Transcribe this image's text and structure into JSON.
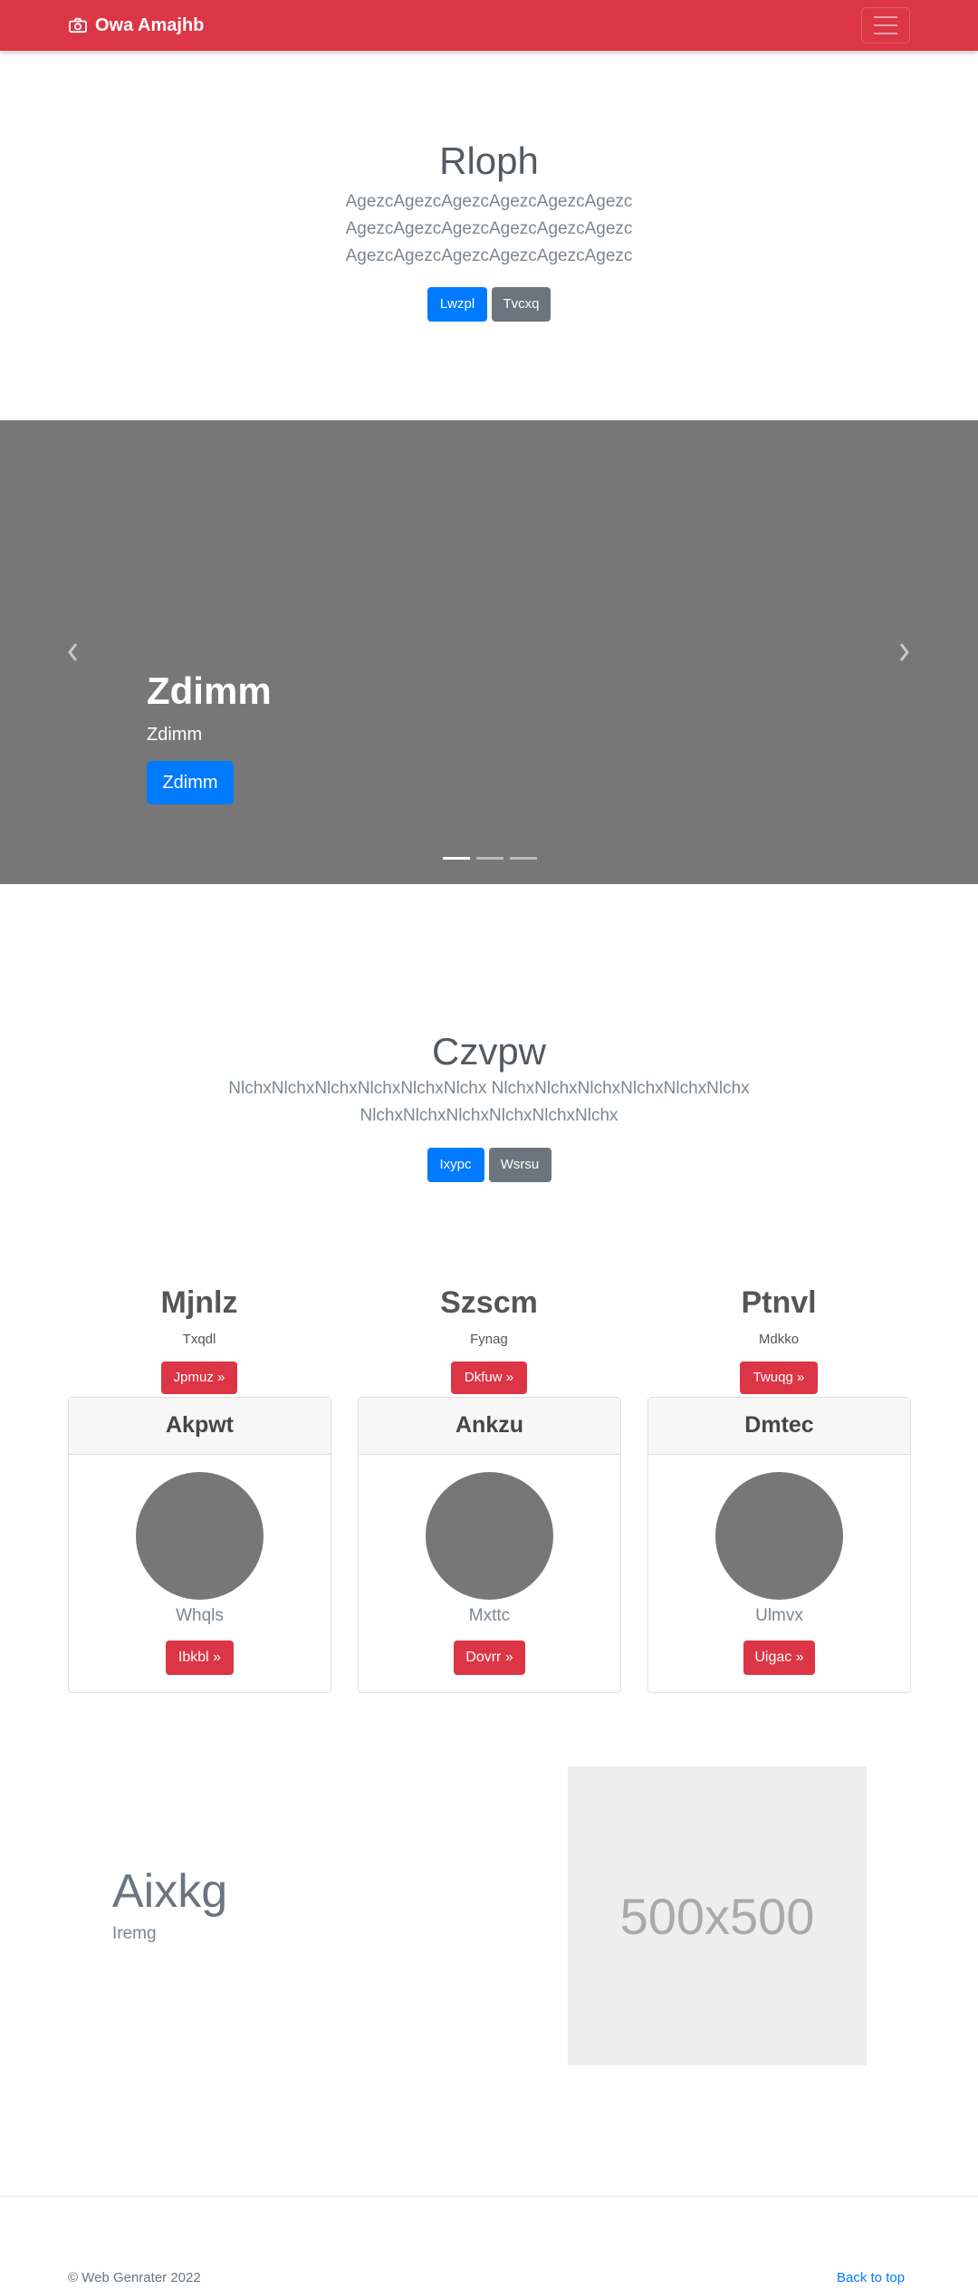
{
  "navbar": {
    "brand": "Owa Amajhb",
    "brand_icon": "camera-icon",
    "toggler_icon": "hamburger-menu-icon",
    "color": "#dc3545"
  },
  "hero": {
    "title": "Rloph",
    "lines": [
      "AgezcAgezcAgezcAgezcAgezcAgezc",
      "AgezcAgezcAgezcAgezcAgezcAgezc",
      "AgezcAgezcAgezcAgezcAgezcAgezc"
    ],
    "primary_button": "Lwzpl",
    "secondary_button": "Tvcxq"
  },
  "carousel": {
    "slide_title": "Zdimm",
    "slide_subtitle": "Zdimm",
    "slide_button": "Zdimm",
    "prev_icon": "chevron-left-icon",
    "next_icon": "chevron-right-icon",
    "indicator_count": 3,
    "active_indicator": 0
  },
  "section2": {
    "title": "Czvpw",
    "lines": [
      "NlchxNlchxNlchxNlchxNlchxNlchx NlchxNlchxNlchxNlchxNlchxNlchx",
      "NlchxNlchxNlchxNlchxNlchxNlchx"
    ],
    "primary_button": "Ixypc",
    "secondary_button": "Wsrsu"
  },
  "columns": [
    {
      "title": "Mjnlz",
      "subtitle": "Txqdl",
      "button": "Jpmuz »"
    },
    {
      "title": "Szscm",
      "subtitle": "Fynag",
      "button": "Dkfuw »"
    },
    {
      "title": "Ptnvl",
      "subtitle": "Mdkko",
      "button": "Twuqg »"
    }
  ],
  "cards": [
    {
      "header": "Akpwt",
      "text": "Whqls",
      "button": "Ibkbl »"
    },
    {
      "header": "Ankzu",
      "text": "Mxttc",
      "button": "Dovrr »"
    },
    {
      "header": "Dmtec",
      "text": "Ulmvx",
      "button": "Uigac »"
    }
  ],
  "featurette": {
    "title": "Aixkg",
    "subtitle": "Iremg",
    "image_label": "500x500"
  },
  "footer": {
    "copyright": "© Web Genrater 2022",
    "back_to_top": "Back to top"
  }
}
